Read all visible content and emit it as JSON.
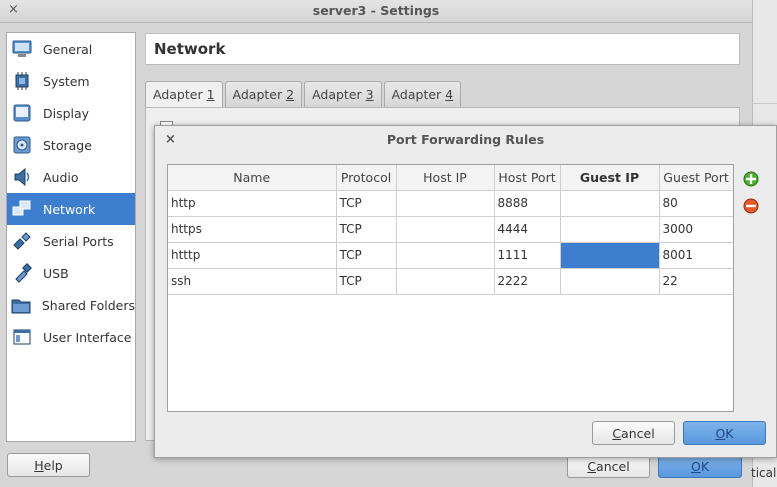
{
  "window": {
    "title": "server3 - Settings",
    "close_glyph": "×"
  },
  "sidebar": {
    "items": [
      {
        "label": "General",
        "icon": "general-icon"
      },
      {
        "label": "System",
        "icon": "system-icon"
      },
      {
        "label": "Display",
        "icon": "display-icon"
      },
      {
        "label": "Storage",
        "icon": "storage-icon"
      },
      {
        "label": "Audio",
        "icon": "audio-icon"
      },
      {
        "label": "Network",
        "icon": "network-icon",
        "selected": true
      },
      {
        "label": "Serial Ports",
        "icon": "serial-ports-icon"
      },
      {
        "label": "USB",
        "icon": "usb-icon"
      },
      {
        "label": "Shared Folders",
        "icon": "shared-folders-icon"
      },
      {
        "label": "User Interface",
        "icon": "user-interface-icon"
      }
    ]
  },
  "section": {
    "title": "Network"
  },
  "tabs": [
    {
      "pre": "Adapter ",
      "key": "1",
      "active": true
    },
    {
      "pre": "Adapter ",
      "key": "2"
    },
    {
      "pre": "Adapter ",
      "key": "3"
    },
    {
      "pre": "Adapter ",
      "key": "4"
    }
  ],
  "footer": {
    "help": {
      "key": "H",
      "rest": "elp"
    },
    "cancel": {
      "key": "C",
      "rest": "ancel"
    },
    "ok": {
      "key": "O",
      "rest": "K"
    },
    "right_fragment": "tical"
  },
  "dialog": {
    "title": "Port Forwarding Rules",
    "close_glyph": "×",
    "columns": [
      "Name",
      "Protocol",
      "Host IP",
      "Host Port",
      "Guest IP",
      "Guest Port"
    ],
    "bold_column": "Guest IP",
    "rows": [
      [
        "http",
        "TCP",
        "",
        "8888",
        "",
        "80"
      ],
      [
        "https",
        "TCP",
        "",
        "4444",
        "",
        "3000"
      ],
      [
        "htttp",
        "TCP",
        "",
        "1111",
        "",
        "8001"
      ],
      [
        "ssh",
        "TCP",
        "",
        "2222",
        "",
        "22"
      ]
    ],
    "selected_cell": {
      "row": 2,
      "column": "Guest IP"
    },
    "side_buttons": [
      "add-rule-icon",
      "remove-rule-icon"
    ],
    "cancel": {
      "key": "C",
      "rest": "ancel"
    },
    "ok": {
      "key": "O",
      "rest": "K"
    }
  },
  "colors": {
    "selection": "#3d7fce",
    "ok_button": "#5a98dd"
  }
}
